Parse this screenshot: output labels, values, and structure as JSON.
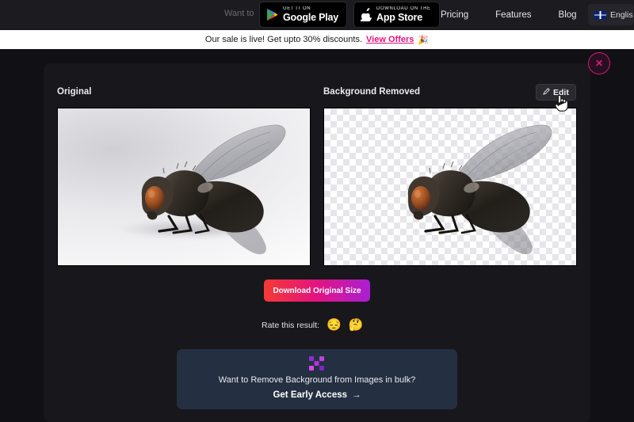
{
  "topnav": {
    "faded_text": "Want to",
    "store_buttons": [
      {
        "name": "google-play",
        "small": "GET IT ON",
        "big": "Google Play",
        "icon": "google-play-icon"
      },
      {
        "name": "app-store",
        "small": "Download on the",
        "big": "App Store",
        "icon": "apple-icon"
      }
    ],
    "links": [
      {
        "label": "Pricing"
      },
      {
        "label": "Features"
      },
      {
        "label": "Blog"
      }
    ],
    "language": {
      "label": "Englis",
      "flag": "uk-flag-icon"
    }
  },
  "banner": {
    "message": "Our sale is live! Get upto 30% discounts.",
    "link_label": "View Offers",
    "emoji": "🎉",
    "link_color": "#e5147d"
  },
  "result": {
    "close_label": "✕",
    "left_label": "Original",
    "right_label": "Background Removed",
    "edit_label": "Edit",
    "edit_icon": "pencil-icon",
    "download_label": "Download Original Size",
    "download_gradient": "#f43b32 → #e5147d → #a81fd6"
  },
  "rating": {
    "label": "Rate this result:",
    "options": [
      {
        "name": "emoji-disappointed",
        "glyph": "😔"
      },
      {
        "name": "emoji-neutral",
        "glyph": "🤔"
      }
    ]
  },
  "promo": {
    "logo": "pixel-cross-logo-icon",
    "headline": "Want to Remove Background from Images in bulk?",
    "cta_label": "Get Early Access",
    "cta_arrow": "→",
    "background": "#243041"
  }
}
